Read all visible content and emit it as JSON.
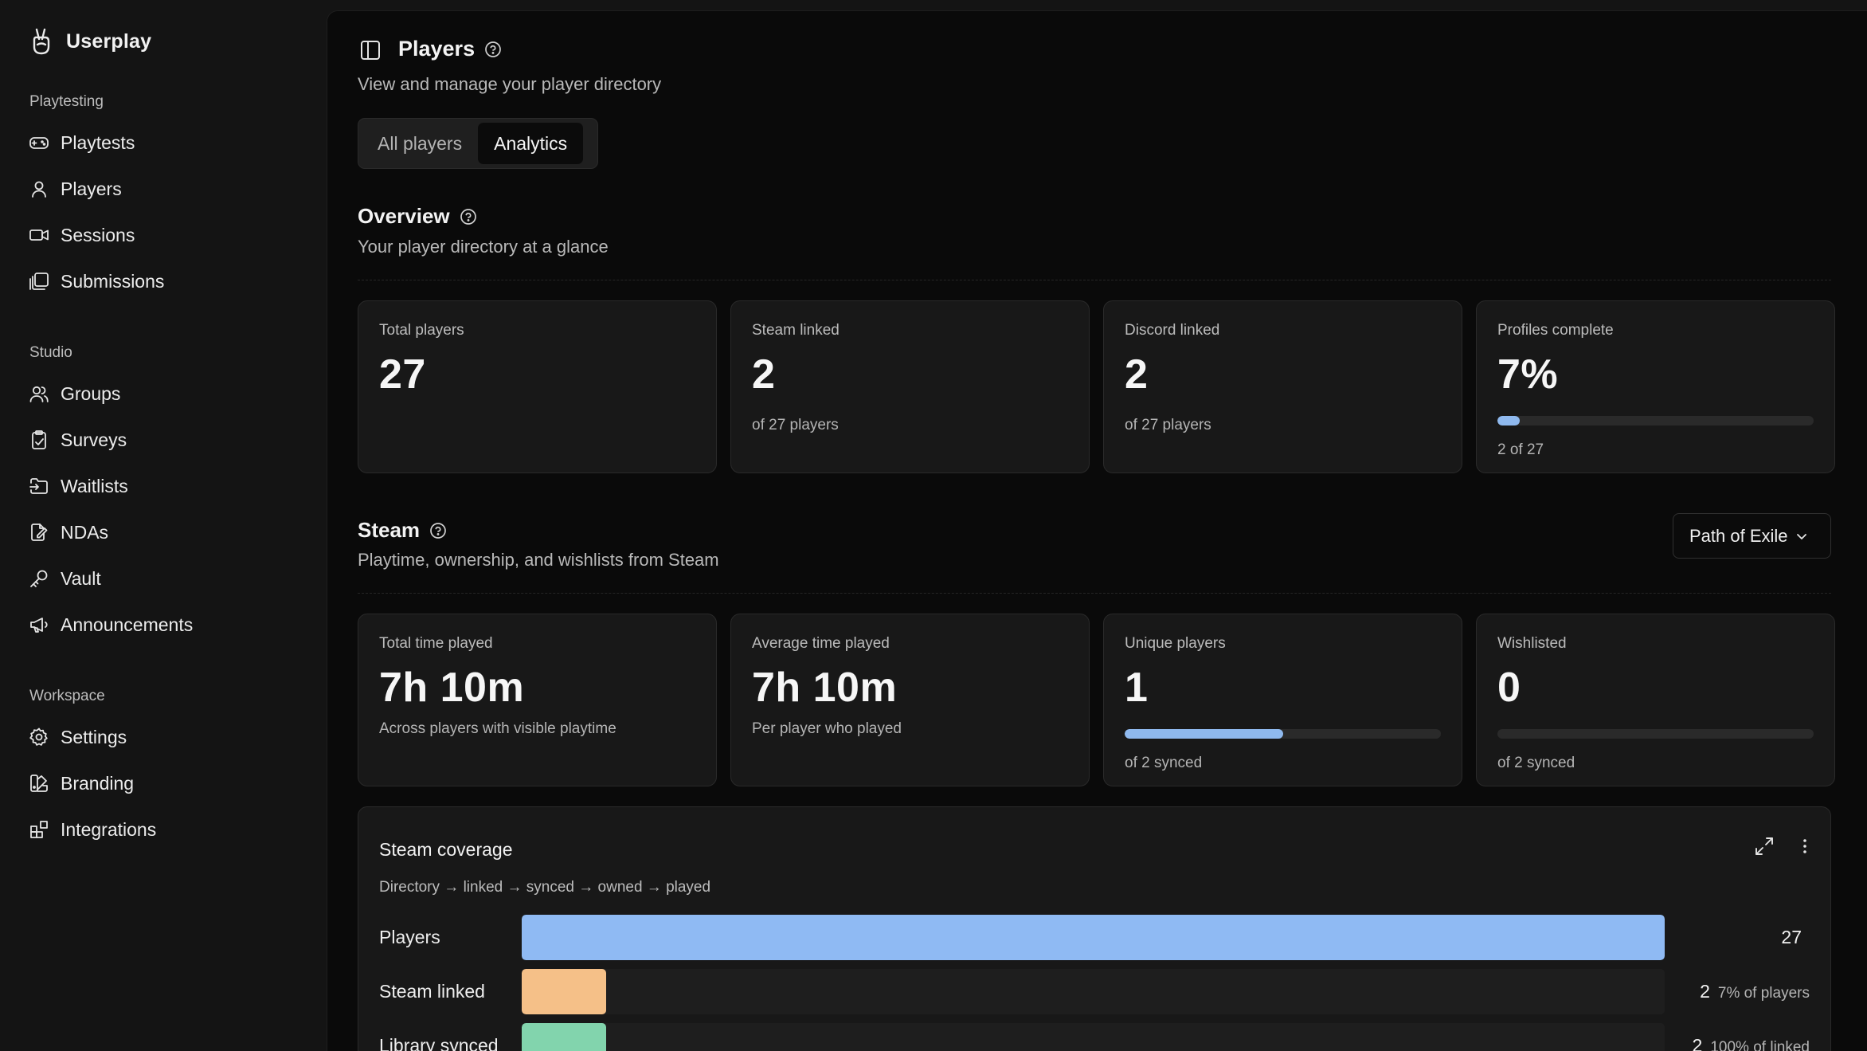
{
  "app": {
    "name": "Userplay"
  },
  "sidebar": {
    "sections": [
      {
        "label": "Playtesting",
        "items": [
          "Playtests",
          "Players",
          "Sessions",
          "Submissions"
        ]
      },
      {
        "label": "Studio",
        "items": [
          "Groups",
          "Surveys",
          "Waitlists",
          "NDAs",
          "Vault",
          "Announcements"
        ]
      },
      {
        "label": "Workspace",
        "items": [
          "Settings",
          "Branding",
          "Integrations"
        ]
      }
    ]
  },
  "header": {
    "title": "Players",
    "subtitle": "View and manage your player directory",
    "tabs": [
      {
        "label": "All players",
        "active": false
      },
      {
        "label": "Analytics",
        "active": true
      }
    ]
  },
  "overview": {
    "title": "Overview",
    "subtitle": "Your player directory at a glance",
    "cards": [
      {
        "label": "Total players",
        "value": "27",
        "note": ""
      },
      {
        "label": "Steam linked",
        "value": "2",
        "note": "of 27 players"
      },
      {
        "label": "Discord linked",
        "value": "2",
        "note": "of 27 players"
      },
      {
        "label": "Profiles complete",
        "value": "7%",
        "note": "2 of 27",
        "progress": 0.07
      }
    ]
  },
  "steam": {
    "title": "Steam",
    "subtitle": "Playtime, ownership, and wishlists from Steam",
    "game_selector": "Path of Exile",
    "cards": [
      {
        "label": "Total time played",
        "value": "7h 10m",
        "note": "Across players with visible playtime"
      },
      {
        "label": "Average time played",
        "value": "7h 10m",
        "note": "Per player who played"
      },
      {
        "label": "Unique players",
        "value": "1",
        "note": "of 2 synced",
        "progress": 0.5
      },
      {
        "label": "Wishlisted",
        "value": "0",
        "note": "of 2 synced",
        "progress": 0
      }
    ]
  },
  "coverage": {
    "title": "Steam coverage",
    "subtitle": "Directory → linked → synced → owned → played",
    "rows": [
      {
        "label": "Players",
        "count": "27",
        "pct": "",
        "fraction": 1.0,
        "color": "#8fbaf3"
      },
      {
        "label": "Steam linked",
        "count": "2",
        "pct": "7% of players",
        "fraction": 0.074,
        "color": "#f5c088"
      },
      {
        "label": "Library synced",
        "count": "2",
        "pct": "100% of linked",
        "fraction": 0.074,
        "color": "#82d4ad"
      }
    ]
  },
  "colors": {
    "accent": "#8fb9ee",
    "background": "#0a0a0a",
    "sidebar": "#141414",
    "card": "#181818"
  }
}
